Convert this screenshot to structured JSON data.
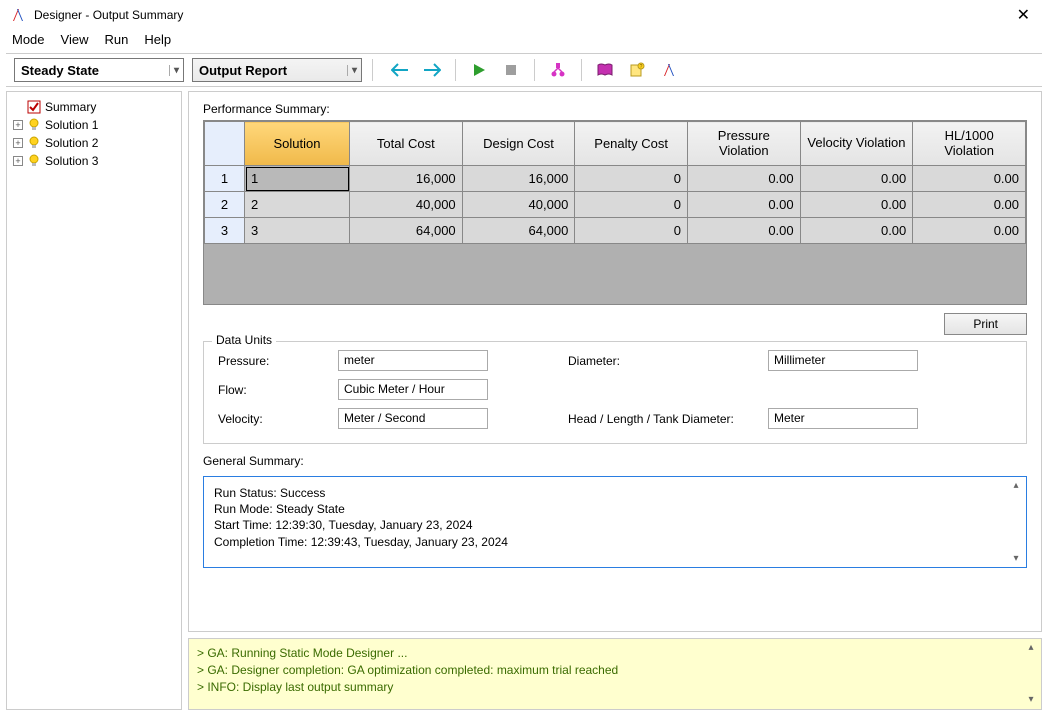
{
  "window": {
    "title": "Designer - Output Summary"
  },
  "menu": {
    "mode": "Mode",
    "view": "View",
    "run": "Run",
    "help": "Help"
  },
  "toolbar": {
    "combo_state": "Steady State",
    "combo_report": "Output Report"
  },
  "tree": {
    "summary": "Summary",
    "sol1": "Solution 1",
    "sol2": "Solution 2",
    "sol3": "Solution 3"
  },
  "perf": {
    "label": "Performance Summary:",
    "headers": {
      "solution": "Solution",
      "total_cost": "Total Cost",
      "design_cost": "Design Cost",
      "penalty_cost": "Penalty Cost",
      "pressure_viol": "Pressure Violation",
      "velocity_viol": "Velocity Violation",
      "hl_viol": "HL/1000 Violation"
    },
    "rows": [
      {
        "n": "1",
        "sol": "1",
        "total": "16,000",
        "design": "16,000",
        "penalty": "0",
        "pv": "0.00",
        "vv": "0.00",
        "hv": "0.00"
      },
      {
        "n": "2",
        "sol": "2",
        "total": "40,000",
        "design": "40,000",
        "penalty": "0",
        "pv": "0.00",
        "vv": "0.00",
        "hv": "0.00"
      },
      {
        "n": "3",
        "sol": "3",
        "total": "64,000",
        "design": "64,000",
        "penalty": "0",
        "pv": "0.00",
        "vv": "0.00",
        "hv": "0.00"
      }
    ],
    "print": "Print"
  },
  "units": {
    "legend": "Data Units",
    "pressure_l": "Pressure:",
    "pressure_v": "meter",
    "flow_l": "Flow:",
    "flow_v": "Cubic Meter / Hour",
    "velocity_l": "Velocity:",
    "velocity_v": "Meter / Second",
    "diameter_l": "Diameter:",
    "diameter_v": "Millimeter",
    "head_l": "Head / Length / Tank Diameter:",
    "head_v": "Meter"
  },
  "general": {
    "label": "General Summary:",
    "line1": "Run Status: Success",
    "line2": "Run Mode: Steady State",
    "line3": "Start Time: 12:39:30, Tuesday, January 23, 2024",
    "line4": "Completion Time: 12:39:43, Tuesday, January 23, 2024"
  },
  "log": {
    "l1": "> GA: Running Static Mode Designer ...",
    "l2": "> GA: Designer completion: GA optimization completed: maximum trial reached",
    "l3": "> INFO: Display last output summary"
  }
}
